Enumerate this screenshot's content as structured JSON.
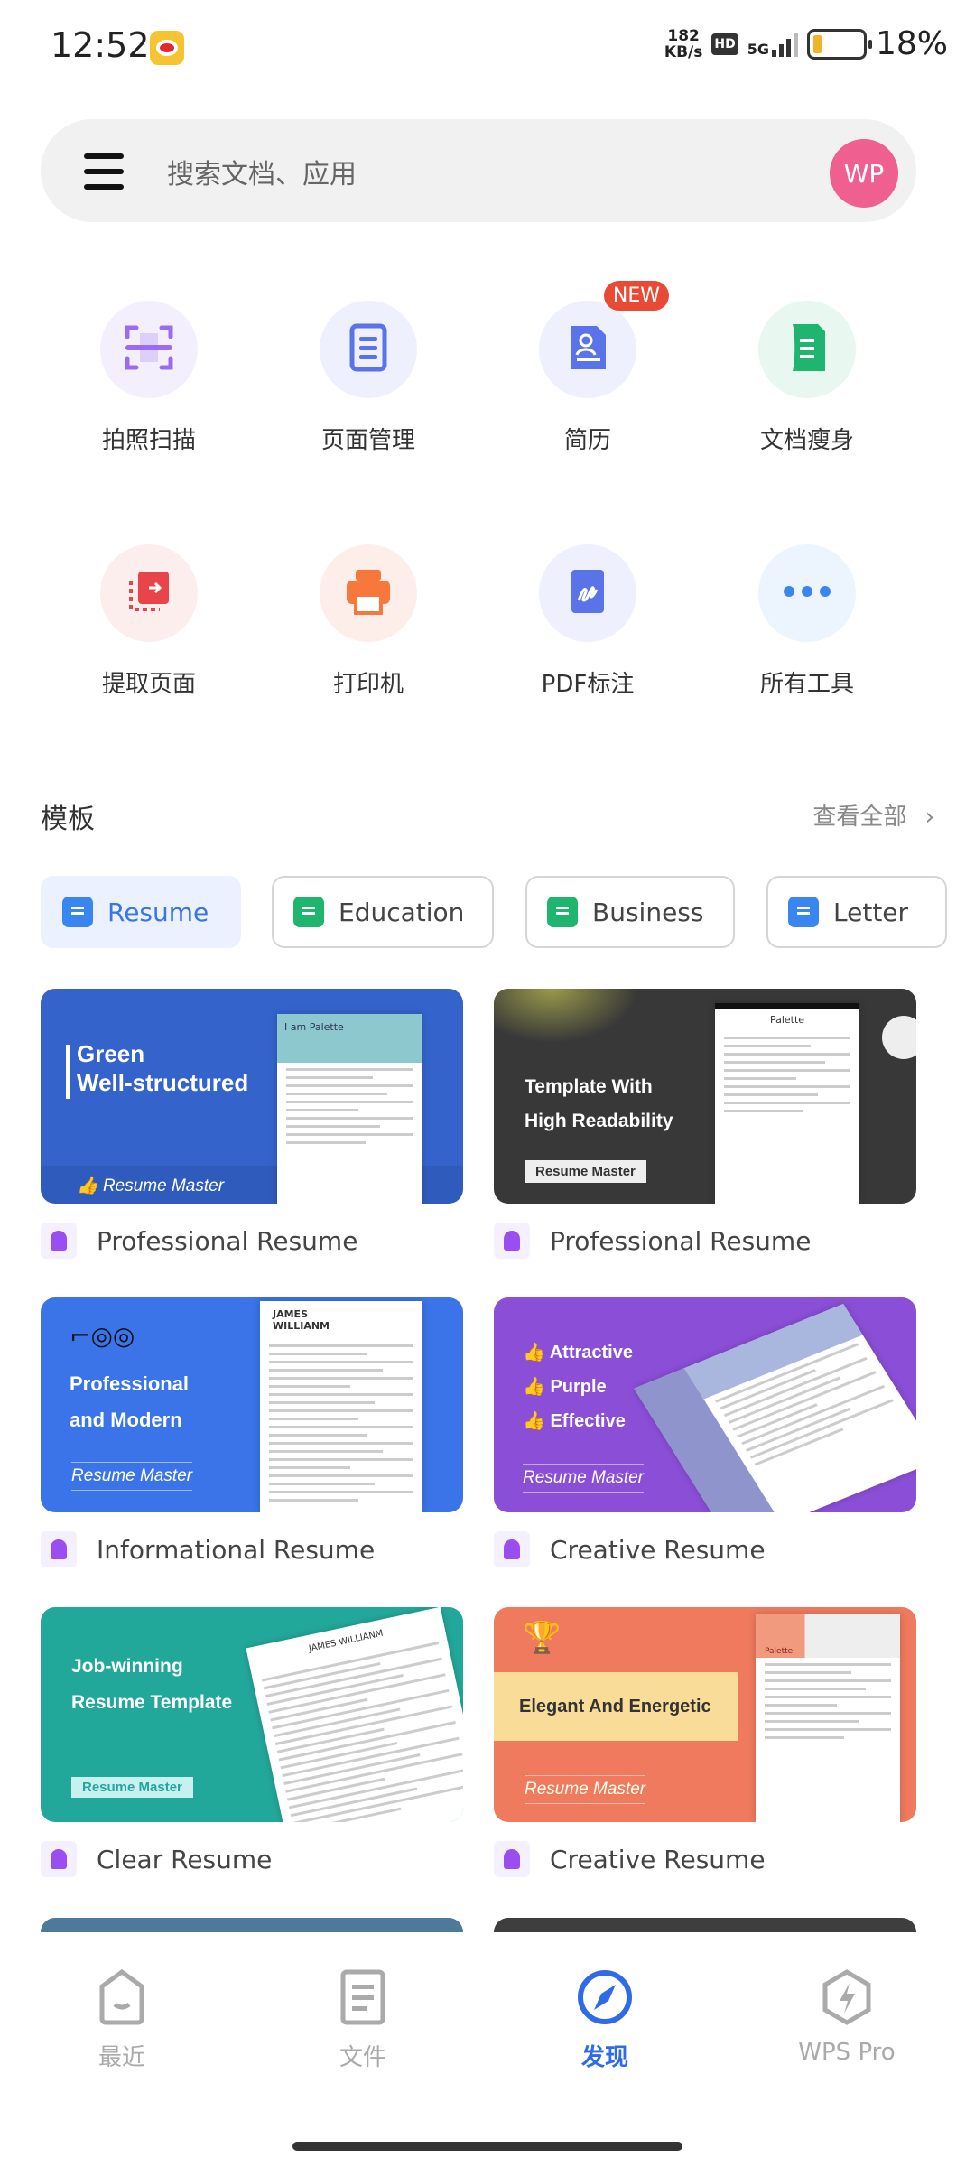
{
  "status_bar": {
    "time": "12:52",
    "net_speed_value": "182",
    "net_speed_unit": "KB/s",
    "hd": "HD",
    "network": "5G",
    "battery": "18%",
    "battery_level": 18
  },
  "search": {
    "placeholder": "搜索文档、应用",
    "avatar_initials": "WP"
  },
  "tools": [
    {
      "label": "拍照扫描",
      "icon": "scan-icon",
      "color": "#9b6cf0",
      "bg": "#f4effd"
    },
    {
      "label": "页面管理",
      "icon": "page-manage-icon",
      "color": "#5b73e8",
      "bg": "#eef1fd"
    },
    {
      "label": "简历",
      "icon": "resume-icon",
      "color": "#5b73e8",
      "bg": "#eef1fd",
      "badge": "NEW"
    },
    {
      "label": "文档瘦身",
      "icon": "compress-icon",
      "color": "#1fb56e",
      "bg": "#e8f8f0"
    },
    {
      "label": "提取页面",
      "icon": "extract-page-icon",
      "color": "#e8454a",
      "bg": "#fdeeee"
    },
    {
      "label": "打印机",
      "icon": "printer-icon",
      "color": "#f7783a",
      "bg": "#fdeeea"
    },
    {
      "label": "PDF标注",
      "icon": "pdf-annotate-icon",
      "color": "#5b73e8",
      "bg": "#eef1fd"
    },
    {
      "label": "所有工具",
      "icon": "more-dots-icon",
      "color": "#3a86f0",
      "bg": "#ecf4fd"
    }
  ],
  "templates": {
    "title": "模板",
    "view_all": "查看全部",
    "categories": [
      {
        "label": "Resume",
        "icon": "resume-icon",
        "color": "#3a86f0",
        "active": true
      },
      {
        "label": "Education",
        "icon": "education-icon",
        "color": "#1fb56e"
      },
      {
        "label": "Business",
        "icon": "business-icon",
        "color": "#1fb56e"
      },
      {
        "label": "Letter",
        "icon": "letter-icon",
        "color": "#3a86f0"
      }
    ],
    "cards": [
      {
        "name": "Professional Resume",
        "headline1": "Green",
        "headline2": "Well-structured",
        "brand": "Resume Master",
        "sheet_name": "I am Palette",
        "bg": "#3463cc"
      },
      {
        "name": "Professional Resume",
        "headline1": "Template With",
        "headline2": "High Readability",
        "brand": "Resume Master",
        "sheet_name": "Palette",
        "bg": "#383838"
      },
      {
        "name": "Informational Resume",
        "headline1": "Professional",
        "headline2": "and Modern",
        "brand": "Resume Master",
        "sheet_name": "JAMES WILLIANM",
        "bg": "#3a74e8"
      },
      {
        "name": "Creative Resume",
        "headline1": "Attractive",
        "headline2": "Purple",
        "headline3": "Effective",
        "brand": "Resume Master",
        "bg": "#8a4fd6"
      },
      {
        "name": "Clear Resume",
        "headline1": "Job-winning",
        "headline2": "Resume Template",
        "brand": "Resume Master",
        "sheet_name": "JAMES WILLIANM",
        "bg": "#22a89a"
      },
      {
        "name": "Creative Resume",
        "headline1": "Elegant And Energetic",
        "brand": "Resume Master",
        "sheet_name": "Palette",
        "bg": "#ef7a5e"
      }
    ]
  },
  "bottom_nav": [
    {
      "label": "最近",
      "icon": "recent-icon"
    },
    {
      "label": "文件",
      "icon": "file-icon"
    },
    {
      "label": "发现",
      "icon": "compass-icon",
      "active": true
    },
    {
      "label": "WPS Pro",
      "icon": "wps-pro-icon"
    }
  ]
}
